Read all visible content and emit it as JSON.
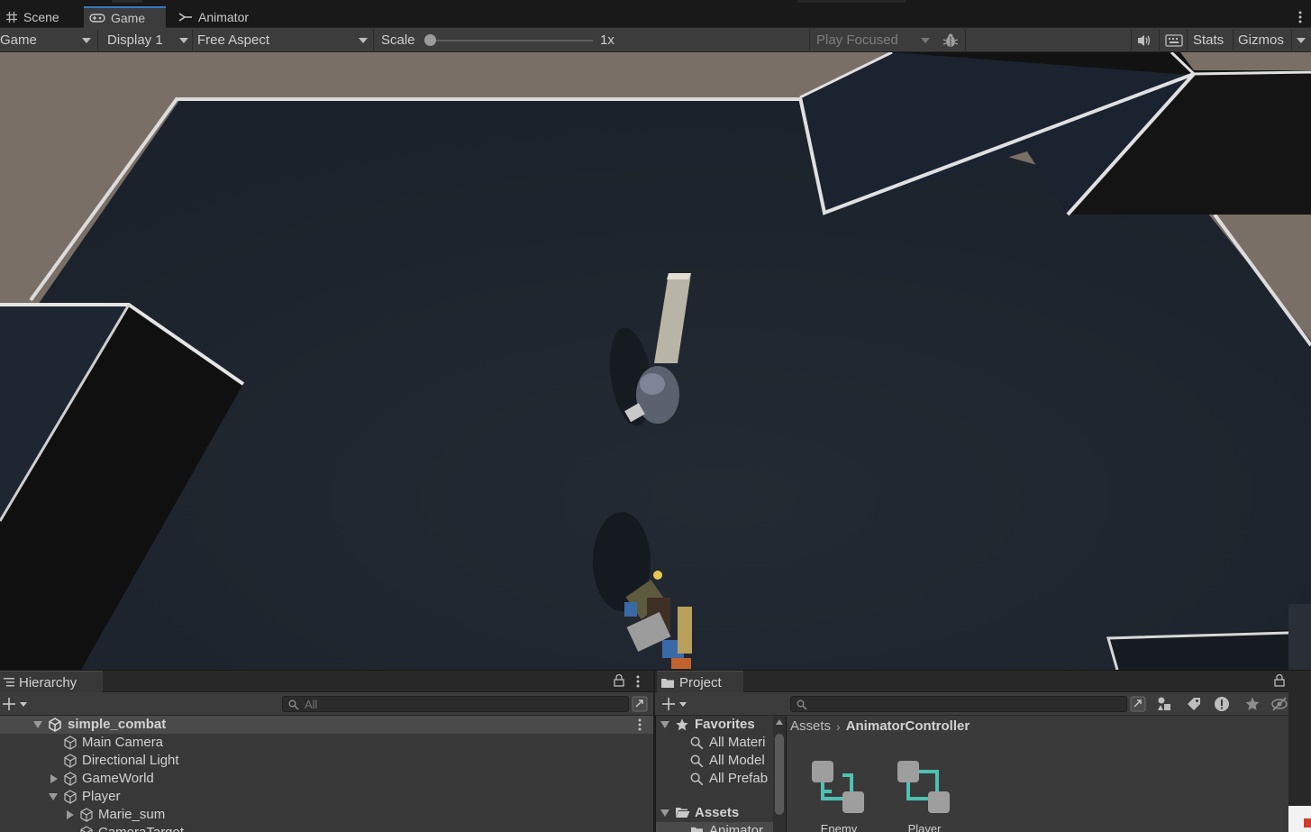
{
  "tabs": {
    "scene": "Scene",
    "game": "Game",
    "animator": "Animator"
  },
  "toolbar": {
    "mode": "Game",
    "display": "Display 1",
    "aspect": "Free Aspect",
    "scale_label": "Scale",
    "scale_value": "1x",
    "scale_level": 0,
    "play_mode": "Play Focused",
    "stats": "Stats",
    "gizmos": "Gizmos"
  },
  "hierarchy": {
    "title": "Hierarchy",
    "search_placeholder": "All",
    "scene_name": "simple_combat",
    "items": [
      {
        "label": "Main Camera"
      },
      {
        "label": "Directional Light"
      },
      {
        "label": "GameWorld"
      },
      {
        "label": "Player"
      },
      {
        "label": "Marie_sum"
      },
      {
        "label": "CameraTarget"
      }
    ]
  },
  "project": {
    "title": "Project",
    "favorites_label": "Favorites",
    "favorites": [
      "All Materi",
      "All Model",
      "All Prefab"
    ],
    "assets_label": "Assets",
    "assets_child": "Animator",
    "breadcrumb": [
      "Assets",
      "AnimatorController"
    ],
    "files": [
      {
        "name": "Enemy"
      },
      {
        "name": "Player"
      }
    ]
  },
  "colors": {
    "accent": "#3a79bb",
    "panel": "#383838",
    "toolbar": "#3c3c3c",
    "floor": "#212731",
    "ground": "#7a6f66",
    "controller_icon_teal": "#4fc1b2"
  }
}
